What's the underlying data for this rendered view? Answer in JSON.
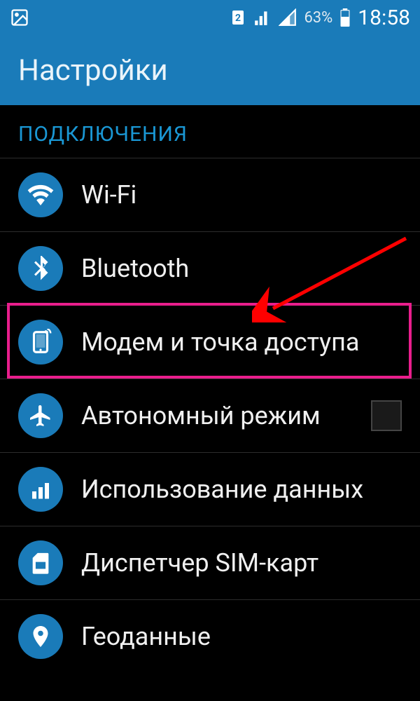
{
  "statusbar": {
    "sim_indicator": "2",
    "battery_pct": "63%",
    "time": "18:58"
  },
  "header": {
    "title": "Настройки"
  },
  "section": {
    "label": "ПОДКЛЮЧЕНИЯ"
  },
  "items": [
    {
      "label": "Wi-Fi"
    },
    {
      "label": "Bluetooth"
    },
    {
      "label": "Модем и точка доступа"
    },
    {
      "label": "Автономный режим"
    },
    {
      "label": "Использование данных"
    },
    {
      "label": "Диспетчер SIM-карт"
    },
    {
      "label": "Геоданные"
    }
  ]
}
